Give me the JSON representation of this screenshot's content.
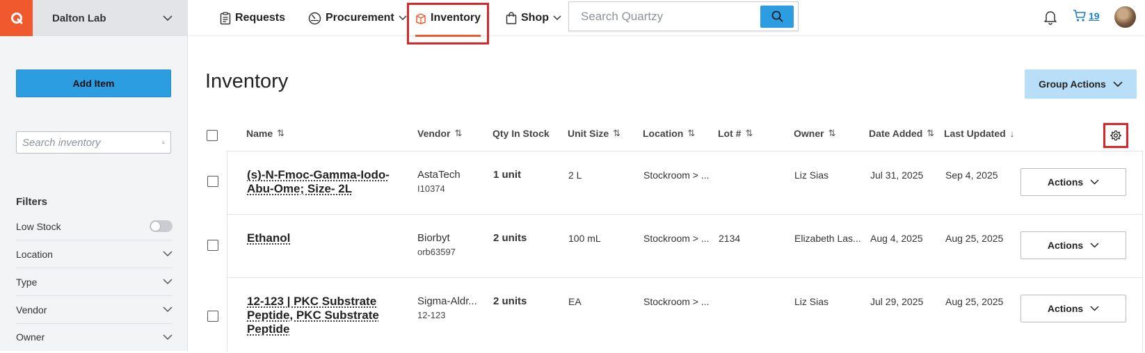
{
  "app": {
    "lab_name": "Dalton Lab"
  },
  "nav": {
    "requests": "Requests",
    "procurement": "Procurement",
    "inventory": "Inventory",
    "shop": "Shop",
    "search_placeholder": "Search Quartzy",
    "cart_count": "19"
  },
  "sidebar": {
    "add_item": "Add Item",
    "search_placeholder": "Search inventory",
    "filters_title": "Filters",
    "filters": [
      "Low Stock",
      "Location",
      "Type",
      "Vendor",
      "Owner"
    ]
  },
  "main": {
    "title": "Inventory",
    "group_actions": "Group Actions",
    "columns": [
      "Name",
      "Vendor",
      "Qty In Stock",
      "Unit Size",
      "Location",
      "Lot #",
      "Owner",
      "Date Added",
      "Last Updated"
    ],
    "rows": [
      {
        "name": "(s)-N-Fmoc-Gamma-Iodo-Abu-Ome; Size- 2L",
        "vendor": "AstaTech",
        "catalog": "I10374",
        "qty": "1 unit",
        "unit_size": "2 L",
        "location": "Stockroom > ...",
        "lot": "",
        "owner": "Liz Sias",
        "date_added": "Jul 31, 2025",
        "last_updated": "Sep 4, 2025",
        "actions": "Actions"
      },
      {
        "name": "Ethanol",
        "vendor": "Biorbyt",
        "catalog": "orb63597",
        "qty": "2 units",
        "unit_size": "100 mL",
        "location": "Stockroom > ...",
        "lot": "2134",
        "owner": "Elizabeth Las...",
        "date_added": "Aug 4, 2025",
        "last_updated": "Aug 25, 2025",
        "actions": "Actions"
      },
      {
        "name": "12-123 | PKC Substrate Peptide, PKC Substrate Peptide",
        "vendor": "Sigma-Aldr...",
        "catalog": "12-123",
        "qty": "2 units",
        "unit_size": "EA",
        "location": "Stockroom > ...",
        "lot": "",
        "owner": "Liz Sias",
        "date_added": "Jul 29, 2025",
        "last_updated": "Aug 25, 2025",
        "actions": "Actions"
      }
    ]
  },
  "colors": {
    "brand_orange": "#f0582d",
    "primary_blue": "#2b9de0",
    "group_actions_bg": "#b9dff8",
    "highlight_red": "#d9262a"
  }
}
